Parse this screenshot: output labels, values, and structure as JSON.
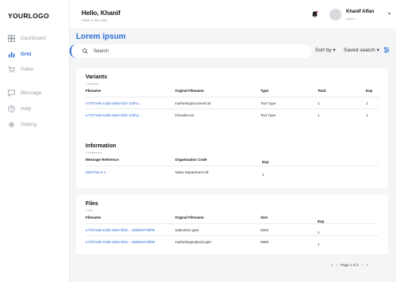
{
  "logo": "YOURLOGO",
  "sidebar": {
    "items": [
      {
        "label": "Dashboard",
        "icon": "dashboard-icon"
      },
      {
        "label": "Grid",
        "icon": "chart-icon"
      },
      {
        "label": "Sales",
        "icon": "cart-icon"
      },
      {
        "label": "Message",
        "icon": "message-icon"
      },
      {
        "label": "Help",
        "icon": "help-icon"
      },
      {
        "label": "Setting",
        "icon": "gear-icon"
      }
    ]
  },
  "header": {
    "greeting": "Hello, Khanif",
    "subtitle": "Have a nice day",
    "user_name": "Khanif Alfan",
    "user_role": "Admin"
  },
  "main": {
    "title": "Lorem ipsum",
    "search_placeholder": "Search",
    "sort_label": "Sort by",
    "saved_label": "Saved search"
  },
  "variants": {
    "title": "Variants",
    "sub": "1 Incident",
    "headers": [
      "Filename",
      "Orginal Filename",
      "Type",
      "Total",
      "Exp"
    ],
    "rows": [
      [
        "e77b7ed6-10dd-4de0-bf2e-10bhu...",
        "marketingdocument.txt",
        "Text Type",
        "1",
        "1"
      ],
      [
        "e77b7ed6-10dd-4de0-bf2e-10bhu...",
        "infosales.txt",
        "Text Type",
        "1",
        "1"
      ]
    ]
  },
  "information": {
    "title": "Information",
    "sub": "1 Reference",
    "headers": [
      "Message Reference",
      "Organisation Code",
      "Exp"
    ],
    "rows": [
      [
        "3604754-2-1",
        "Sales Department 05",
        "1"
      ]
    ]
  },
  "files": {
    "title": "Files",
    "sub": "1 File",
    "headers": [
      "Filename",
      "Orginal Filename",
      "Size",
      "Exp"
    ],
    "rows": [
      [
        "e77b7ed6-10dd-4de0-bf2e-...a8969370df99",
        "sales2021.pptx",
        "8345",
        "1"
      ],
      [
        "e77b7ed6-10dd-4de0-bf2e-...a8969370df99",
        "marketinganalysis.pptx",
        "9658",
        "1"
      ]
    ]
  },
  "pager": {
    "label": "Page 1 of 1"
  },
  "colors": {
    "accent": "#2f6fd6",
    "background": "#f4f5f7"
  }
}
